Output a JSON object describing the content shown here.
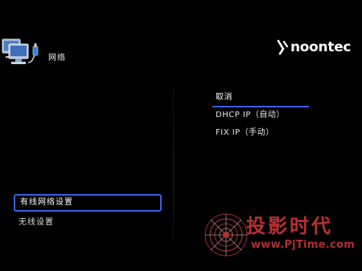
{
  "header": {
    "title": "网络",
    "icon": "network-computers-icon"
  },
  "brand": {
    "name": "noontec",
    "icon": "noontec-logo-mark"
  },
  "left_menu": {
    "items": [
      {
        "label": "有线网络设置",
        "selected": true
      },
      {
        "label": "无线设置",
        "selected": false
      }
    ]
  },
  "right_menu": {
    "items": [
      {
        "label": "取消",
        "selected": true
      },
      {
        "label": "DHCP IP（自动）",
        "selected": false
      },
      {
        "label": "FIX IP（手动）",
        "selected": false
      }
    ]
  },
  "watermark": {
    "title": "投影时代",
    "url": "www.PjTime.com"
  },
  "colors": {
    "background": "#000000",
    "accent": "#3b5ee0",
    "text": "#e6e6e6",
    "watermark": "#d83a3a"
  }
}
